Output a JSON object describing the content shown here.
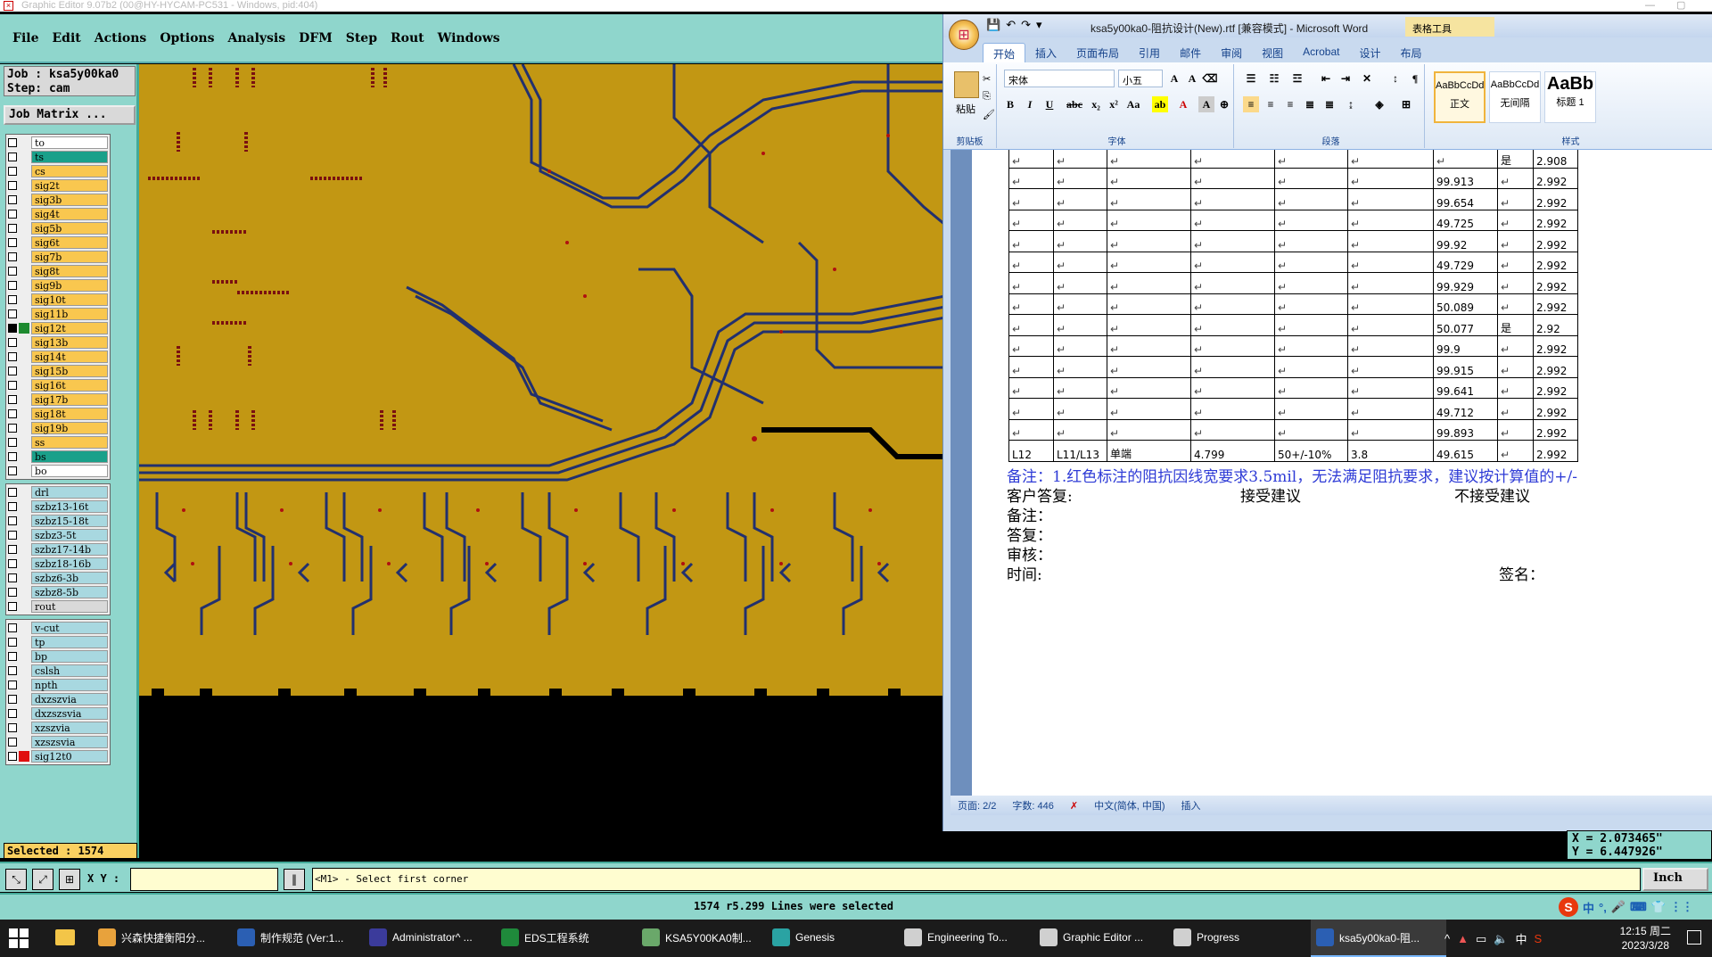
{
  "ge": {
    "title": "Graphic Editor 9.07b2 (00@HY-HYCAM-PC531 - Windows, pid:404)",
    "menu": [
      "File",
      "Edit",
      "Actions",
      "Options",
      "Analysis",
      "DFM",
      "Step",
      "Rout",
      "Windows"
    ],
    "job_line": "Job : ksa5y00ka0",
    "step_line": "Step: cam",
    "matrix_button": "Job Matrix ...",
    "layer_groups": [
      [
        {
          "name": "to",
          "color": "#ffffff"
        },
        {
          "name": "ts",
          "color": "#1aa08a"
        },
        {
          "name": "cs",
          "color": "#f9c74f"
        },
        {
          "name": "sig2t",
          "color": "#f9c74f"
        },
        {
          "name": "sig3b",
          "color": "#f9c74f"
        },
        {
          "name": "sig4t",
          "color": "#f9c74f"
        },
        {
          "name": "sig5b",
          "color": "#f9c74f"
        },
        {
          "name": "sig6t",
          "color": "#f9c74f"
        },
        {
          "name": "sig7b",
          "color": "#f9c74f"
        },
        {
          "name": "sig8t",
          "color": "#f9c74f"
        },
        {
          "name": "sig9b",
          "color": "#f9c74f"
        },
        {
          "name": "sig10t",
          "color": "#f9c74f"
        },
        {
          "name": "sig11b",
          "color": "#f9c74f"
        },
        {
          "name": "sig12t",
          "color": "#f9c74f"
        },
        {
          "name": "sig13b",
          "color": "#f9c74f"
        },
        {
          "name": "sig14t",
          "color": "#f9c74f"
        },
        {
          "name": "sig15b",
          "color": "#f9c74f"
        },
        {
          "name": "sig16t",
          "color": "#f9c74f"
        },
        {
          "name": "sig17b",
          "color": "#f9c74f"
        },
        {
          "name": "sig18t",
          "color": "#f9c74f"
        },
        {
          "name": "sig19b",
          "color": "#f9c74f"
        },
        {
          "name": "ss",
          "color": "#f9c74f"
        },
        {
          "name": "bs",
          "color": "#1aa08a"
        },
        {
          "name": "bo",
          "color": "#ffffff"
        }
      ],
      [
        {
          "name": "drl",
          "color": "#a8d8e0"
        },
        {
          "name": "szbz13-16t",
          "color": "#a8d8e0"
        },
        {
          "name": "szbz15-18t",
          "color": "#a8d8e0"
        },
        {
          "name": "szbz3-5t",
          "color": "#a8d8e0"
        },
        {
          "name": "szbz17-14b",
          "color": "#a8d8e0"
        },
        {
          "name": "szbz18-16b",
          "color": "#a8d8e0"
        },
        {
          "name": "szbz6-3b",
          "color": "#a8d8e0"
        },
        {
          "name": "szbz8-5b",
          "color": "#a8d8e0"
        },
        {
          "name": "rout",
          "color": "#d9d9d9"
        }
      ],
      [
        {
          "name": "v-cut",
          "color": "#a8d8e0"
        },
        {
          "name": "tp",
          "color": "#a8d8e0"
        },
        {
          "name": "bp",
          "color": "#a8d8e0"
        },
        {
          "name": "cslsh",
          "color": "#a8d8e0"
        },
        {
          "name": "npth",
          "color": "#a8d8e0"
        },
        {
          "name": "dxzszvia",
          "color": "#a8d8e0"
        },
        {
          "name": "dxzszsvia",
          "color": "#a8d8e0"
        },
        {
          "name": "xzszvia",
          "color": "#a8d8e0"
        },
        {
          "name": "xzszsvia",
          "color": "#a8d8e0"
        },
        {
          "name": "sig12t0",
          "color": "#a8d8e0"
        }
      ]
    ],
    "selected": "Selected : 1574",
    "xy_label": "X Y :",
    "prompt": "<M1> - Select first corner",
    "units": "Inch",
    "coord_x": "X = 2.073465\"",
    "coord_y": "Y = 6.447926\"",
    "status": "1574 r5.299 Lines were selected"
  },
  "word": {
    "title": "ksa5y00ka0-阻抗设计(New).rtf [兼容模式] - Microsoft Word",
    "context_tab": "表格工具",
    "tabs": [
      "开始",
      "插入",
      "页面布局",
      "引用",
      "邮件",
      "审阅",
      "视图",
      "Acrobat",
      "设计",
      "布局"
    ],
    "font_name": "宋体",
    "font_size": "小五",
    "groups": [
      "剪贴板",
      "字体",
      "段落",
      "样式"
    ],
    "paste_label": "粘贴",
    "styles": [
      {
        "sample": "AaBbCcDd",
        "name": "正文"
      },
      {
        "sample": "AaBbCcDd",
        "name": "无间隔"
      },
      {
        "sample": "AaBb",
        "name": "标题 1"
      }
    ],
    "table_rows": [
      [
        "",
        "",
        "",
        "",
        "",
        "",
        "",
        "是",
        "2.908"
      ],
      [
        "",
        "",
        "",
        "",
        "",
        "",
        "99.913",
        "",
        "2.992"
      ],
      [
        "",
        "",
        "",
        "",
        "",
        "",
        "99.654",
        "",
        "2.992"
      ],
      [
        "",
        "",
        "",
        "",
        "",
        "",
        "49.725",
        "",
        "2.992"
      ],
      [
        "",
        "",
        "",
        "",
        "",
        "",
        "99.92",
        "",
        "2.992"
      ],
      [
        "",
        "",
        "",
        "",
        "",
        "",
        "49.729",
        "",
        "2.992"
      ],
      [
        "",
        "",
        "",
        "",
        "",
        "",
        "99.929",
        "",
        "2.992"
      ],
      [
        "",
        "",
        "",
        "",
        "",
        "",
        "50.089",
        "",
        "2.992"
      ],
      [
        "",
        "",
        "",
        "",
        "",
        "",
        "50.077",
        "是",
        "2.92"
      ],
      [
        "",
        "",
        "",
        "",
        "",
        "",
        "99.9",
        "",
        "2.992"
      ],
      [
        "",
        "",
        "",
        "",
        "",
        "",
        "99.915",
        "",
        "2.992"
      ],
      [
        "",
        "",
        "",
        "",
        "",
        "",
        "99.641",
        "",
        "2.992"
      ],
      [
        "",
        "",
        "",
        "",
        "",
        "",
        "49.712",
        "",
        "2.992"
      ],
      [
        "",
        "",
        "",
        "",
        "",
        "",
        "99.893",
        "",
        "2.992"
      ],
      [
        "L12",
        "L11/L13",
        "单端",
        "4.799",
        "50+/-10%",
        "3.8",
        "49.615",
        "",
        "2.992"
      ]
    ],
    "note_line": "备注：1.红色标注的阻抗因线宽要求3.5mil，无法满足阻抗要求，建议按计算值的+/-",
    "reply_label": "客户答复:",
    "accept": "接受建议",
    "reject": "不接受建议",
    "remark": "备注：",
    "answer": "答复：",
    "review": "审核：",
    "time": "时间:",
    "sign": "签名：",
    "status_page": "页面: 2/2",
    "status_words": "字数: 446",
    "status_lang": "中文(简体, 中国)",
    "status_insert": "插入"
  },
  "taskbar": {
    "items": [
      {
        "label": "兴森快捷衡阳分...",
        "color": "#e8a23c"
      },
      {
        "label": "制作规范 (Ver:1...",
        "color": "#2b5fb3"
      },
      {
        "label": "Administrator^ ...",
        "color": "#3b3b9b"
      },
      {
        "label": "EDS工程系统",
        "color": "#1f8a3b"
      },
      {
        "label": "KSA5Y00KA0制...",
        "color": "#6aa86a"
      },
      {
        "label": "Genesis",
        "color": "#2aa3a3"
      },
      {
        "label": "Engineering To...",
        "color": "#d0d0d0"
      },
      {
        "label": "Graphic Editor ...",
        "color": "#d0d0d0"
      },
      {
        "label": "Progress",
        "color": "#d0d0d0"
      },
      {
        "label": "ksa5y00ka0-阻...",
        "color": "#2b5fb3"
      }
    ],
    "time": "12:15 周二",
    "date": "2023/3/28",
    "tray_lang": "中"
  }
}
